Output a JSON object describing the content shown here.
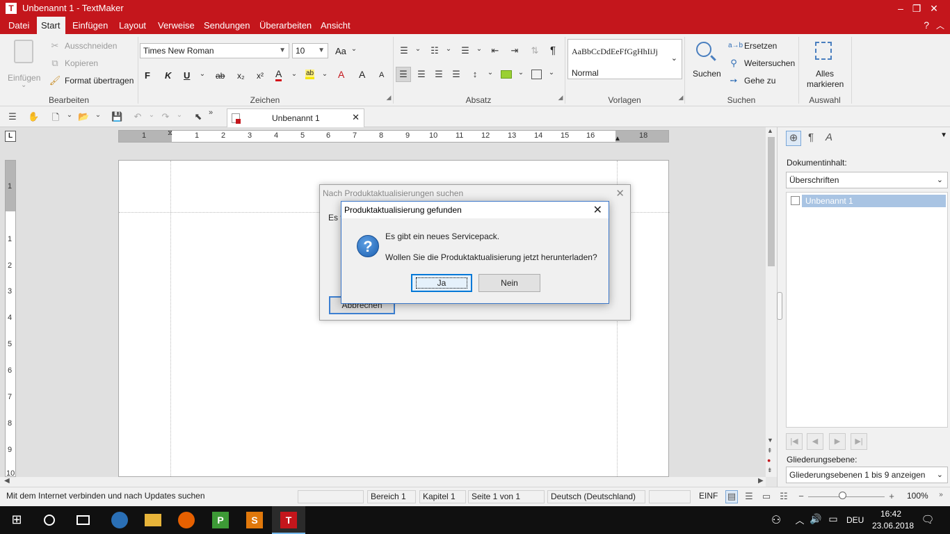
{
  "window": {
    "logo": "T",
    "title": "Unbenannt 1 - TextMaker",
    "minimize": "–",
    "maximize": "❐",
    "close": "✕"
  },
  "menu": {
    "items": [
      "Datei",
      "Start",
      "Einfügen",
      "Layout",
      "Verweise",
      "Sendungen",
      "Überarbeiten",
      "Ansicht"
    ],
    "active": "Start",
    "help": "?",
    "collapse": "︿"
  },
  "ribbon": {
    "clipboard": {
      "paste": "Einfügen",
      "cut": "Ausschneiden",
      "copy": "Kopieren",
      "format_painter": "Format übertragen",
      "group": "Bearbeiten"
    },
    "font": {
      "family": "Times New Roman",
      "size": "10",
      "case": "Aa",
      "bold": "F",
      "italic": "K",
      "underline": "U",
      "strike": "ab",
      "sub": "x₂",
      "sup": "x²",
      "color": "A",
      "highlight": "ab",
      "clear": "A",
      "grow": "A",
      "shrink": "A",
      "group": "Zeichen"
    },
    "paragraph": {
      "pilcrow": "¶",
      "group": "Absatz"
    },
    "styles": {
      "preview": "AaBbCcDdEeFfGgHhIiJj",
      "current": "Normal",
      "group": "Vorlagen"
    },
    "search": {
      "find": "Suchen",
      "replace": "Ersetzen",
      "find_next": "Weitersuchen",
      "goto": "Gehe zu",
      "replace_icon": "a→b",
      "group": "Suchen"
    },
    "select": {
      "select_all_1": "Alles",
      "select_all_2": "markieren",
      "group": "Auswahl"
    }
  },
  "doc_tab": {
    "label": "Unbenannt 1",
    "close": "✕"
  },
  "ruler": {
    "corner": "L",
    "h_numbers": [
      "1",
      "1",
      "2",
      "3",
      "4",
      "5",
      "6",
      "7",
      "8",
      "9",
      "10",
      "11",
      "12",
      "13",
      "14",
      "15",
      "16",
      "18"
    ],
    "v_numbers": [
      "1",
      "1",
      "2",
      "3",
      "4",
      "5",
      "6",
      "7",
      "8",
      "9",
      "10"
    ]
  },
  "sidebar": {
    "content_label": "Dokumentinhalt:",
    "content_select": "Überschriften",
    "tree_item": "Unbenannt 1",
    "level_label": "Gliederungsebene:",
    "level_select": "Gliederungsebenen 1 bis 9 anzeigen"
  },
  "dialog_back": {
    "title": "Nach Produktaktualisierungen suchen",
    "body": "Es v",
    "button": "Abbrechen"
  },
  "dialog_front": {
    "title": "Produktaktualisierung gefunden",
    "message1": "Es gibt ein neues Servicepack.",
    "message2": "Wollen Sie die Produktaktualisierung jetzt herunterladen?",
    "yes": "Ja",
    "no": "Nein"
  },
  "status": {
    "message": "Mit dem Internet verbinden und nach Updates suchen",
    "section": "Bereich 1",
    "chapter": "Kapitel 1",
    "page": "Seite 1 von 1",
    "language": "Deutsch (Deutschland)",
    "mode": "EINF",
    "zoom": "100%",
    "zoom_level": 0.45
  },
  "taskbar": {
    "apps": [
      {
        "name": "thunderbird",
        "color": "#2a6fb5"
      },
      {
        "name": "explorer",
        "color": "#e7b43a"
      },
      {
        "name": "firefox",
        "color": "#e66000"
      },
      {
        "name": "planmaker",
        "letter": "P",
        "color": "#3d9a36"
      },
      {
        "name": "presentations",
        "letter": "S",
        "color": "#e0780b"
      },
      {
        "name": "textmaker",
        "letter": "T",
        "color": "#c4161c"
      }
    ],
    "lang": "DEU",
    "time": "16:42",
    "date": "23.06.2018"
  },
  "colors": {
    "accent": "#c4161c",
    "selection": "#a9c4e3",
    "focus": "#0078d7"
  }
}
